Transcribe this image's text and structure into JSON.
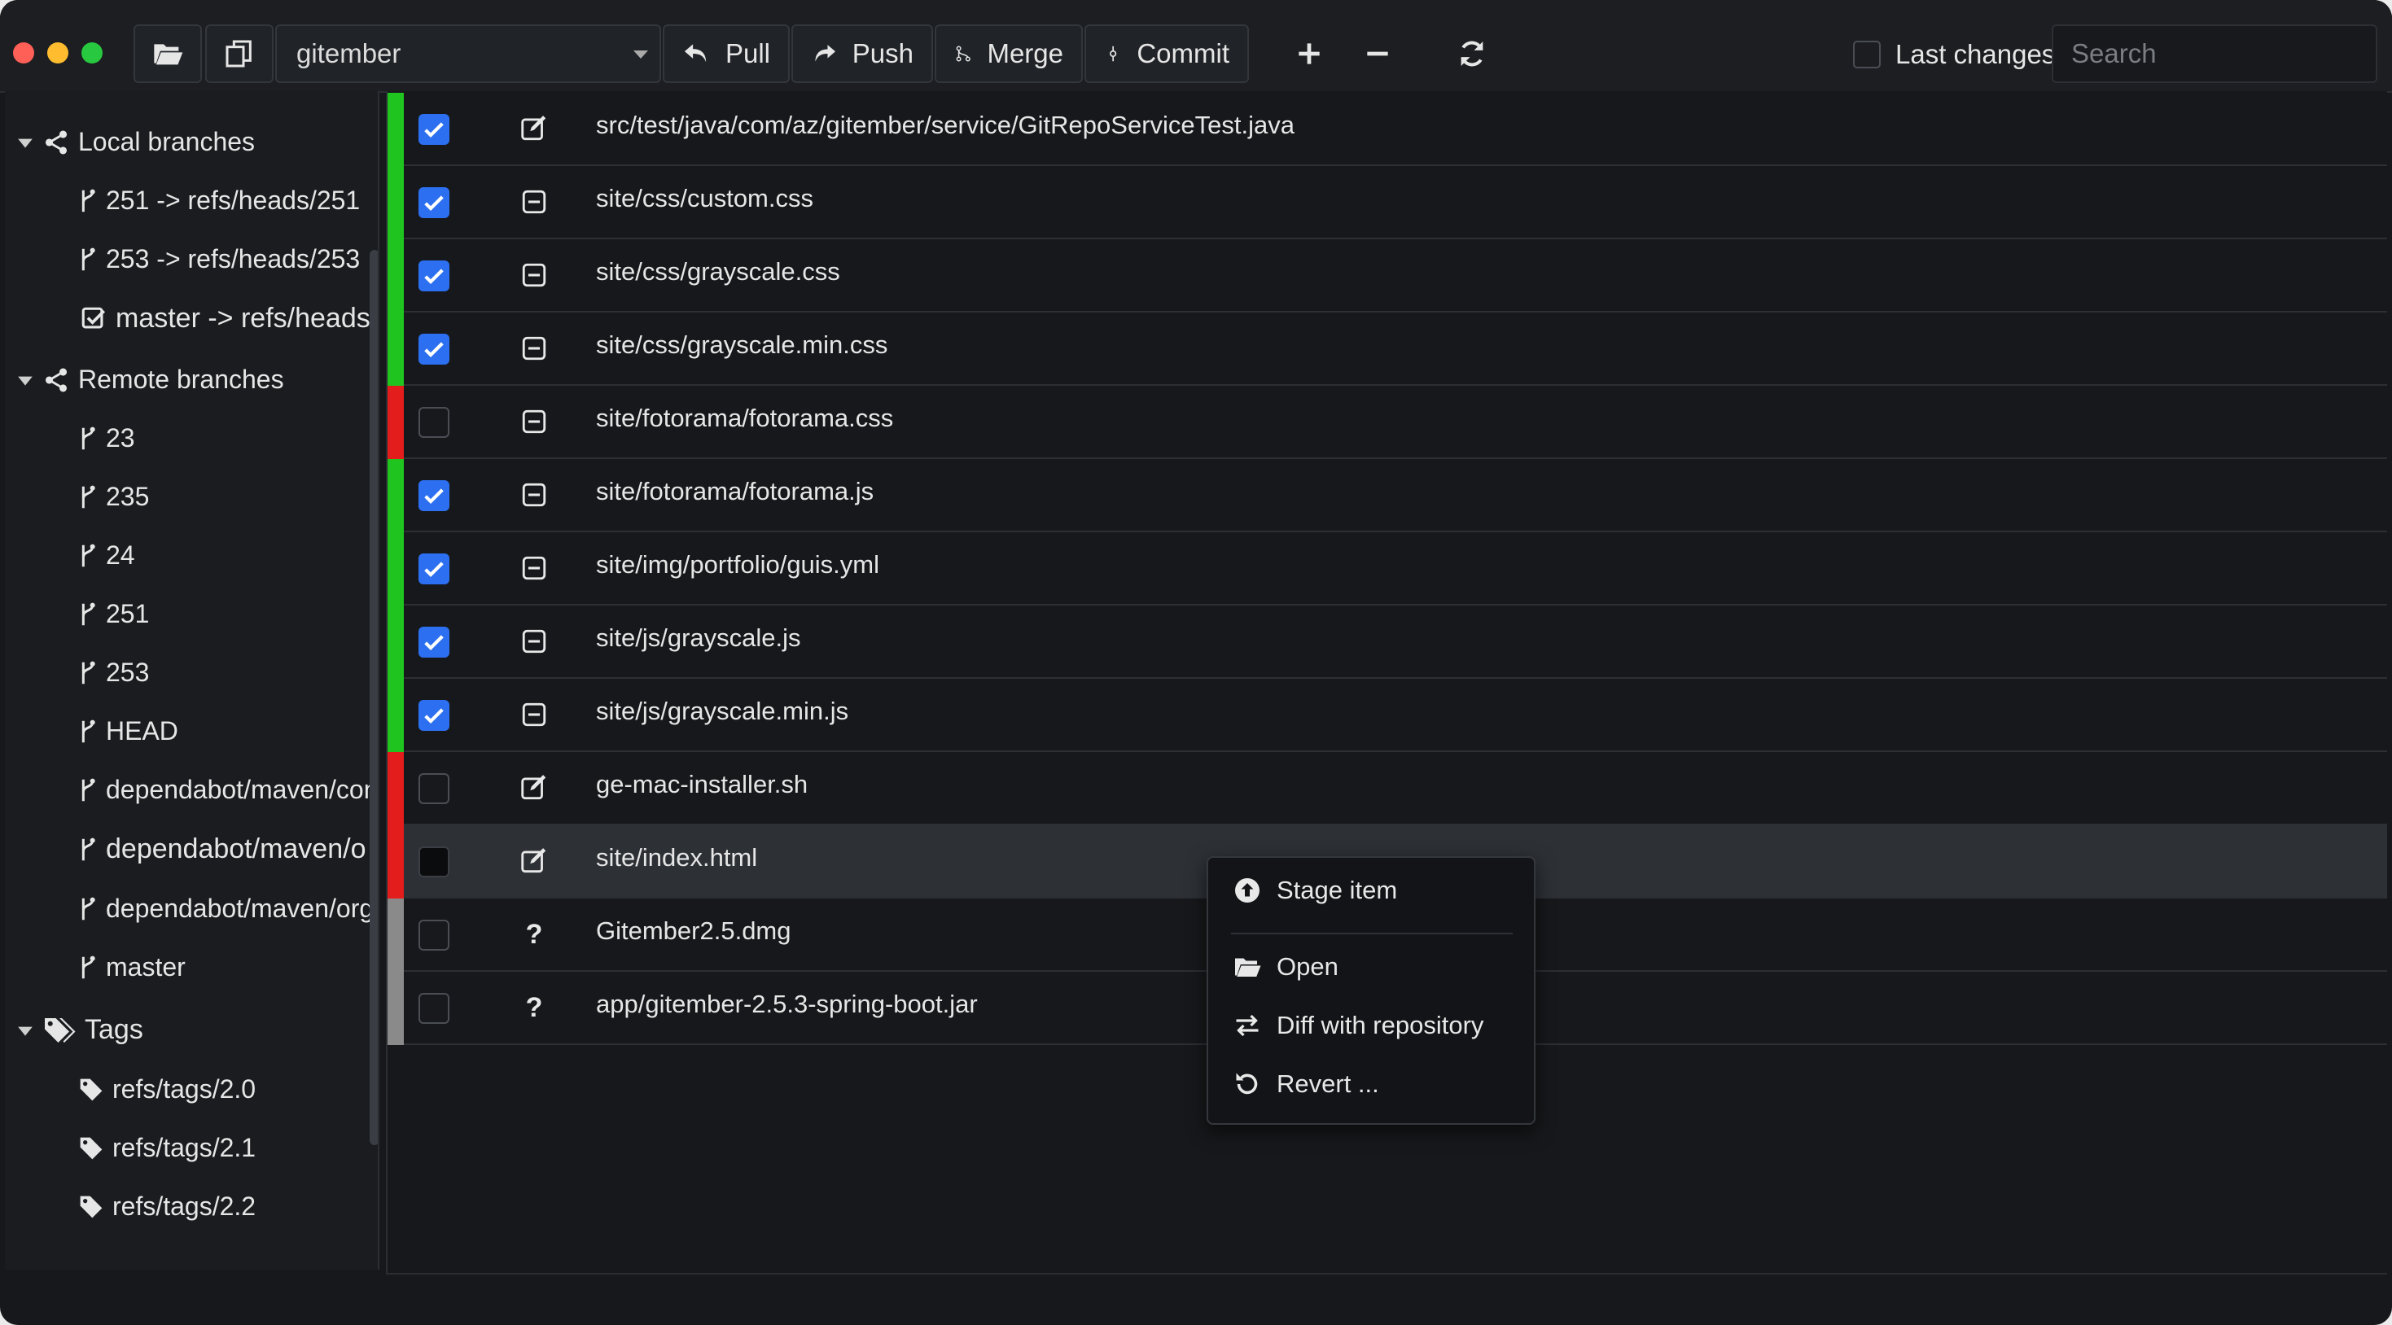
{
  "toolbar": {
    "repo": "gitember",
    "pull": "Pull",
    "push": "Push",
    "merge": "Merge",
    "commit": "Commit",
    "last_changes": "Last changes",
    "search_placeholder": "Search"
  },
  "sidebar": {
    "local_branches": {
      "label": "Local branches",
      "items": [
        "251 -> refs/heads/251",
        "253 -> refs/heads/253",
        "master -> refs/heads/master"
      ]
    },
    "remote_branches": {
      "label": "Remote branches",
      "items": [
        "23",
        "235",
        "24",
        "251",
        "253",
        "HEAD",
        "dependabot/maven/com",
        "dependabot/maven/o",
        "dependabot/maven/org.",
        "master"
      ]
    },
    "tags": {
      "label": "Tags",
      "items": [
        "refs/tags/2.0",
        "refs/tags/2.1",
        "refs/tags/2.2"
      ]
    }
  },
  "files": [
    {
      "path": "src/test/java/com/az/gitember/service/GitRepoServiceTest.java",
      "status": "modified",
      "checked": true,
      "strip": "#1fc41f"
    },
    {
      "path": "site/css/custom.css",
      "status": "removed",
      "checked": true,
      "strip": "#1fc41f"
    },
    {
      "path": "site/css/grayscale.css",
      "status": "removed",
      "checked": true,
      "strip": "#1fc41f"
    },
    {
      "path": "site/css/grayscale.min.css",
      "status": "removed",
      "checked": true,
      "strip": "#1fc41f"
    },
    {
      "path": "site/fotorama/fotorama.css",
      "status": "removed",
      "checked": false,
      "strip": "#e31c1c"
    },
    {
      "path": "site/fotorama/fotorama.js",
      "status": "removed",
      "checked": true,
      "strip": "#1fc41f"
    },
    {
      "path": "site/img/portfolio/guis.yml",
      "status": "removed",
      "checked": true,
      "strip": "#1fc41f"
    },
    {
      "path": "site/js/grayscale.js",
      "status": "removed",
      "checked": true,
      "strip": "#1fc41f"
    },
    {
      "path": "site/js/grayscale.min.js",
      "status": "removed",
      "checked": true,
      "strip": "#1fc41f"
    },
    {
      "path": "ge-mac-installer.sh",
      "status": "modified",
      "checked": false,
      "strip": "#e31c1c"
    },
    {
      "path": "site/index.html",
      "status": "modified",
      "checked": false,
      "strip": "#e31c1c",
      "selected": true
    },
    {
      "path": "Gitember2.5.dmg",
      "status": "untracked",
      "checked": false,
      "strip": "#8a8a8a"
    },
    {
      "path": "app/gitember-2.5.3-spring-boot.jar",
      "status": "untracked",
      "checked": false,
      "strip": "#8a8a8a"
    }
  ],
  "untracked_symbol": "?",
  "context_menu": {
    "stage": "Stage item",
    "open": "Open",
    "diff": "Diff with repository",
    "revert": "Revert ..."
  },
  "colors": {
    "accent": "#2c6ff0",
    "staged": "#1fc41f",
    "unstaged": "#e31c1c",
    "untracked": "#8a8a8a"
  }
}
